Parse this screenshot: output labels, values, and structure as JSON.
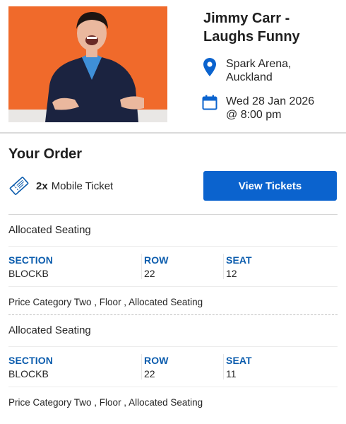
{
  "event": {
    "title": "Jimmy Carr -\nLaughs Funny",
    "title_line1": "Jimmy Carr -",
    "title_line2": "Laughs Funny",
    "venue_line1": "Spark Arena,",
    "venue_line2": "Auckland",
    "date_line1": "Wed 28 Jan 2026",
    "date_line2": "@ 8:00 pm",
    "image_background": "#f06a2b"
  },
  "order": {
    "heading": "Your Order",
    "quantity": "2x",
    "ticket_type": "Mobile Ticket",
    "view_button_label": "View Tickets",
    "accent_color": "#0b63ce"
  },
  "tickets": [
    {
      "seating_type": "Allocated Seating",
      "section_label": "SECTION",
      "section": "BLOCKB",
      "row_label": "ROW",
      "row": "22",
      "seat_label": "SEAT",
      "seat": "12",
      "price_category": "Price Category Two , Floor , Allocated Seating"
    },
    {
      "seating_type": "Allocated Seating",
      "section_label": "SECTION",
      "section": "BLOCKB",
      "row_label": "ROW",
      "row": "22",
      "seat_label": "SEAT",
      "seat": "11",
      "price_category": "Price Category Two , Floor , Allocated Seating"
    }
  ],
  "icons": {
    "venue": "map-pin-icon",
    "date": "calendar-icon",
    "ticket": "ticket-icon"
  }
}
